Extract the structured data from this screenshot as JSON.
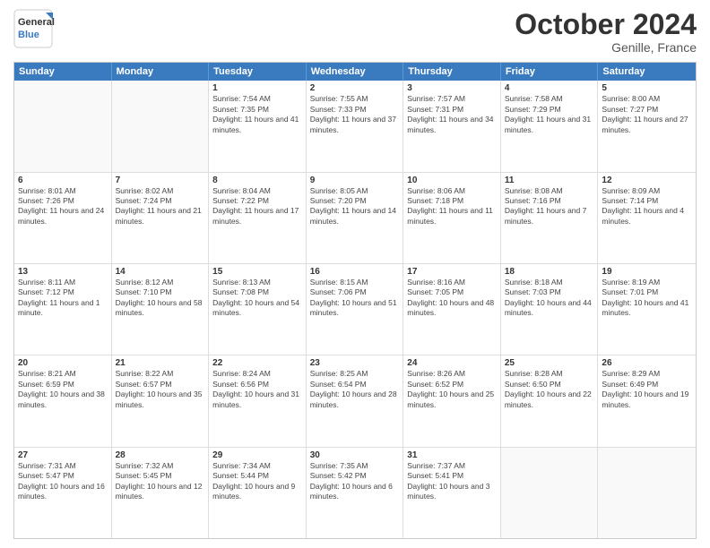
{
  "header": {
    "logo_line1": "General",
    "logo_line2": "Blue",
    "month": "October 2024",
    "location": "Genille, France"
  },
  "weekdays": [
    "Sunday",
    "Monday",
    "Tuesday",
    "Wednesday",
    "Thursday",
    "Friday",
    "Saturday"
  ],
  "weeks": [
    [
      {
        "day": "",
        "info": ""
      },
      {
        "day": "",
        "info": ""
      },
      {
        "day": "1",
        "info": "Sunrise: 7:54 AM\nSunset: 7:35 PM\nDaylight: 11 hours and 41 minutes."
      },
      {
        "day": "2",
        "info": "Sunrise: 7:55 AM\nSunset: 7:33 PM\nDaylight: 11 hours and 37 minutes."
      },
      {
        "day": "3",
        "info": "Sunrise: 7:57 AM\nSunset: 7:31 PM\nDaylight: 11 hours and 34 minutes."
      },
      {
        "day": "4",
        "info": "Sunrise: 7:58 AM\nSunset: 7:29 PM\nDaylight: 11 hours and 31 minutes."
      },
      {
        "day": "5",
        "info": "Sunrise: 8:00 AM\nSunset: 7:27 PM\nDaylight: 11 hours and 27 minutes."
      }
    ],
    [
      {
        "day": "6",
        "info": "Sunrise: 8:01 AM\nSunset: 7:26 PM\nDaylight: 11 hours and 24 minutes."
      },
      {
        "day": "7",
        "info": "Sunrise: 8:02 AM\nSunset: 7:24 PM\nDaylight: 11 hours and 21 minutes."
      },
      {
        "day": "8",
        "info": "Sunrise: 8:04 AM\nSunset: 7:22 PM\nDaylight: 11 hours and 17 minutes."
      },
      {
        "day": "9",
        "info": "Sunrise: 8:05 AM\nSunset: 7:20 PM\nDaylight: 11 hours and 14 minutes."
      },
      {
        "day": "10",
        "info": "Sunrise: 8:06 AM\nSunset: 7:18 PM\nDaylight: 11 hours and 11 minutes."
      },
      {
        "day": "11",
        "info": "Sunrise: 8:08 AM\nSunset: 7:16 PM\nDaylight: 11 hours and 7 minutes."
      },
      {
        "day": "12",
        "info": "Sunrise: 8:09 AM\nSunset: 7:14 PM\nDaylight: 11 hours and 4 minutes."
      }
    ],
    [
      {
        "day": "13",
        "info": "Sunrise: 8:11 AM\nSunset: 7:12 PM\nDaylight: 11 hours and 1 minute."
      },
      {
        "day": "14",
        "info": "Sunrise: 8:12 AM\nSunset: 7:10 PM\nDaylight: 10 hours and 58 minutes."
      },
      {
        "day": "15",
        "info": "Sunrise: 8:13 AM\nSunset: 7:08 PM\nDaylight: 10 hours and 54 minutes."
      },
      {
        "day": "16",
        "info": "Sunrise: 8:15 AM\nSunset: 7:06 PM\nDaylight: 10 hours and 51 minutes."
      },
      {
        "day": "17",
        "info": "Sunrise: 8:16 AM\nSunset: 7:05 PM\nDaylight: 10 hours and 48 minutes."
      },
      {
        "day": "18",
        "info": "Sunrise: 8:18 AM\nSunset: 7:03 PM\nDaylight: 10 hours and 44 minutes."
      },
      {
        "day": "19",
        "info": "Sunrise: 8:19 AM\nSunset: 7:01 PM\nDaylight: 10 hours and 41 minutes."
      }
    ],
    [
      {
        "day": "20",
        "info": "Sunrise: 8:21 AM\nSunset: 6:59 PM\nDaylight: 10 hours and 38 minutes."
      },
      {
        "day": "21",
        "info": "Sunrise: 8:22 AM\nSunset: 6:57 PM\nDaylight: 10 hours and 35 minutes."
      },
      {
        "day": "22",
        "info": "Sunrise: 8:24 AM\nSunset: 6:56 PM\nDaylight: 10 hours and 31 minutes."
      },
      {
        "day": "23",
        "info": "Sunrise: 8:25 AM\nSunset: 6:54 PM\nDaylight: 10 hours and 28 minutes."
      },
      {
        "day": "24",
        "info": "Sunrise: 8:26 AM\nSunset: 6:52 PM\nDaylight: 10 hours and 25 minutes."
      },
      {
        "day": "25",
        "info": "Sunrise: 8:28 AM\nSunset: 6:50 PM\nDaylight: 10 hours and 22 minutes."
      },
      {
        "day": "26",
        "info": "Sunrise: 8:29 AM\nSunset: 6:49 PM\nDaylight: 10 hours and 19 minutes."
      }
    ],
    [
      {
        "day": "27",
        "info": "Sunrise: 7:31 AM\nSunset: 5:47 PM\nDaylight: 10 hours and 16 minutes."
      },
      {
        "day": "28",
        "info": "Sunrise: 7:32 AM\nSunset: 5:45 PM\nDaylight: 10 hours and 12 minutes."
      },
      {
        "day": "29",
        "info": "Sunrise: 7:34 AM\nSunset: 5:44 PM\nDaylight: 10 hours and 9 minutes."
      },
      {
        "day": "30",
        "info": "Sunrise: 7:35 AM\nSunset: 5:42 PM\nDaylight: 10 hours and 6 minutes."
      },
      {
        "day": "31",
        "info": "Sunrise: 7:37 AM\nSunset: 5:41 PM\nDaylight: 10 hours and 3 minutes."
      },
      {
        "day": "",
        "info": ""
      },
      {
        "day": "",
        "info": ""
      }
    ]
  ]
}
